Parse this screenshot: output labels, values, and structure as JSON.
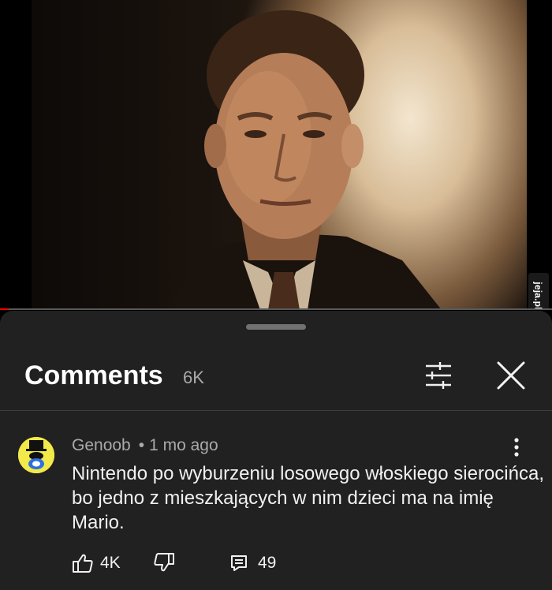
{
  "video": {
    "watermark": "jeja.pl",
    "progress": 0.015,
    "progress_color": "#ff0000"
  },
  "comments_panel": {
    "title": "Comments",
    "count": "6K",
    "filter_icon": "sliders-icon",
    "close_icon": "close-icon"
  },
  "comment": {
    "author": "Genoob",
    "separator": "•",
    "time": "1 mo ago",
    "text": "Nintendo po wyburzeniu losowego włoskiego sierocińca, bo jedno z mieszkających w nim dzieci ma na imię Mario.",
    "likes": "4K",
    "replies": "49",
    "avatar_color": "#f2e94a"
  },
  "colors": {
    "background": "#000000",
    "panel": "#212121",
    "text_primary": "#f1f1f1",
    "text_secondary": "#aaaaaa"
  }
}
